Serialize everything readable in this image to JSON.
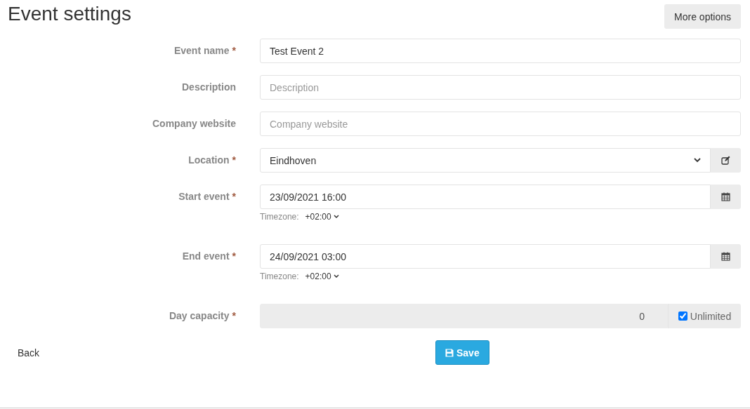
{
  "title": "Event settings",
  "more_button": "More options",
  "fields": [
    {
      "kind": "text",
      "label": "Event name",
      "mark": "*",
      "value": "Test Event 2"
    },
    {
      "kind": "text",
      "label": "Description",
      "placeholder": "Description"
    },
    {
      "kind": "text",
      "label": "Company website",
      "placeholder": "Company website"
    },
    {
      "kind": "select",
      "label": "Location",
      "mark": "*",
      "value": "Eindhoven"
    },
    {
      "kind": "datetime",
      "label": "Start event",
      "mark": "*",
      "value": "23/09/2021 16:00",
      "tz_label": "Timezone:",
      "tz_value": "+02:00"
    },
    {
      "kind": "datetime",
      "label": "End event",
      "mark": "*",
      "value": "24/09/2021 03:00",
      "tz_label": "Timezone:",
      "tz_value": "+02:00"
    },
    {
      "kind": "capacity",
      "label": "Day capacity",
      "mark": "*",
      "value": "0",
      "check_label": "Unlimited",
      "checked": true
    }
  ],
  "back": "Back",
  "save": "Save"
}
